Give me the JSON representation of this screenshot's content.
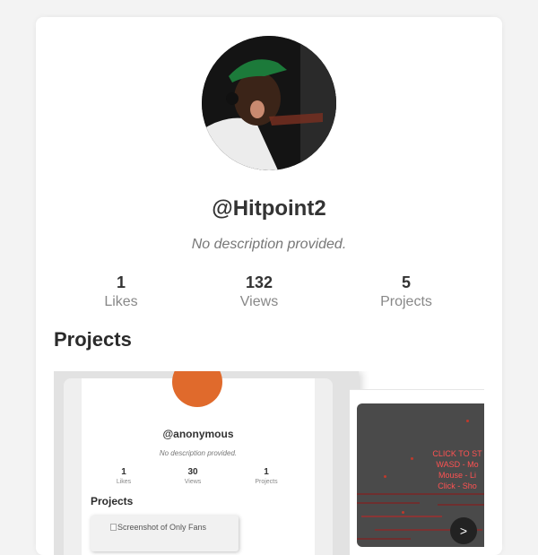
{
  "profile": {
    "username": "@Hitpoint2",
    "description": "No description provided.",
    "stats": [
      {
        "value": "1",
        "label": "Likes"
      },
      {
        "value": "132",
        "label": "Views"
      },
      {
        "value": "5",
        "label": "Projects"
      }
    ]
  },
  "projects": {
    "title": "Projects",
    "items": [
      {
        "preview": {
          "username": "@anonymous",
          "description": "No description provided.",
          "stats": [
            {
              "value": "1",
              "label": "Likes"
            },
            {
              "value": "30",
              "label": "Views"
            },
            {
              "value": "1",
              "label": "Projects"
            }
          ],
          "projects_title": "Projects",
          "screenshot_alt": "Screenshot of Only Fans"
        }
      },
      {
        "preview": {
          "game_lines": [
            "CLICK TO ST",
            "WASD - Mo",
            "Mouse - Li",
            "Click - Sho"
          ]
        }
      }
    ],
    "next_label": ">"
  },
  "colors": {
    "accent_game_text": "#ff5252",
    "mini_avatar": "#e06a2c",
    "background": "#f3f3f3"
  }
}
